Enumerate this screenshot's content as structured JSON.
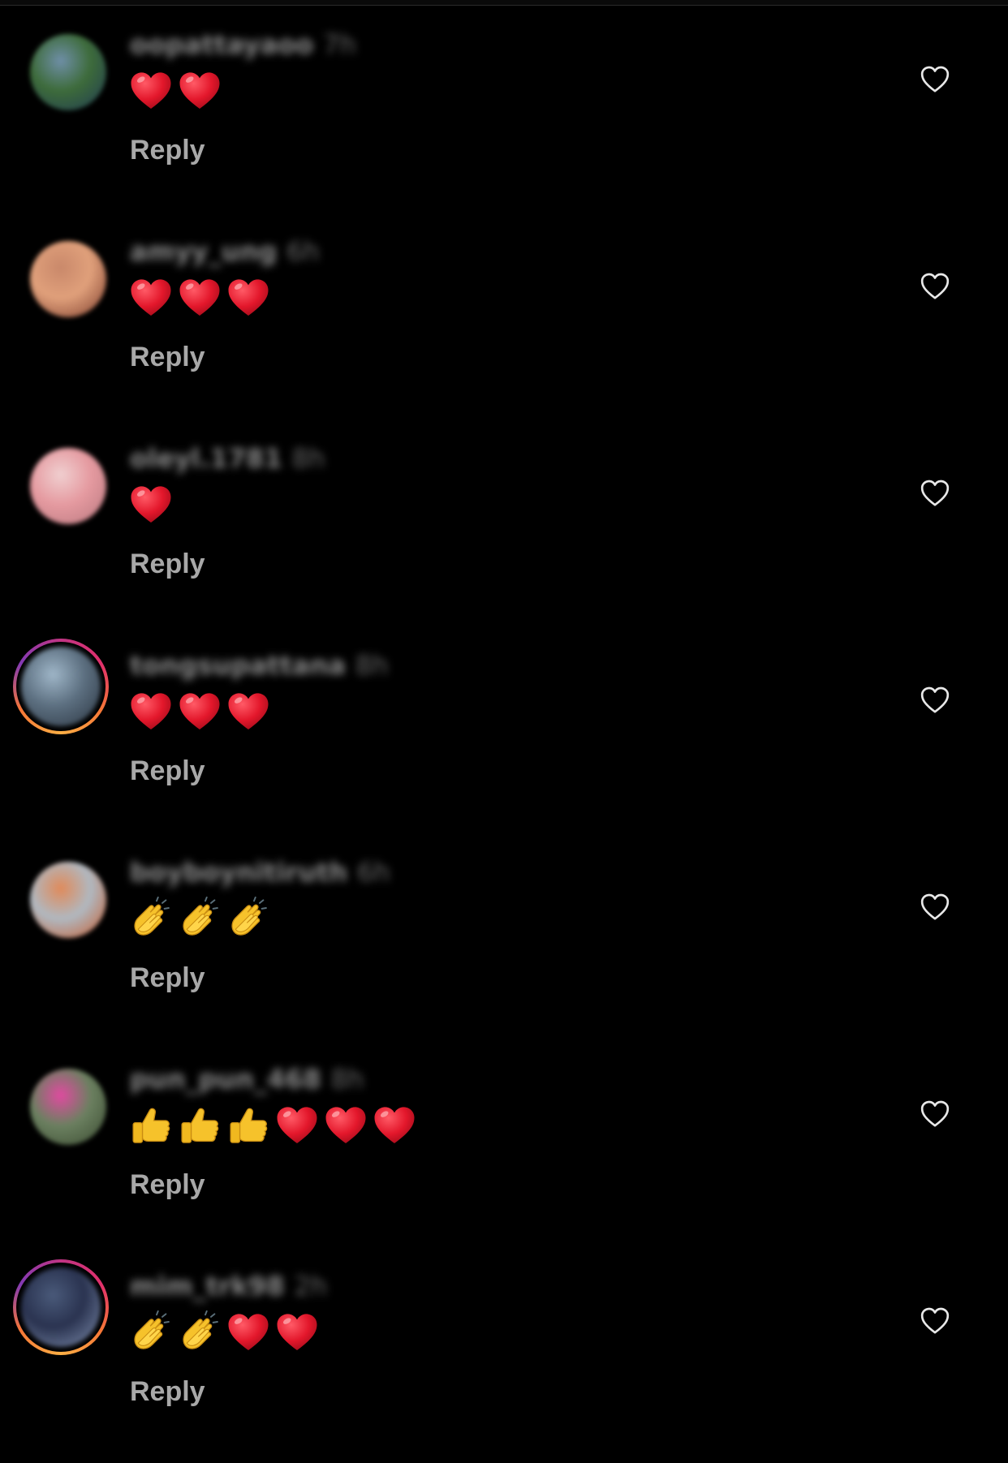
{
  "reply_label": "Reply",
  "colors": {
    "background": "#000000",
    "reply": "#a8a8a8",
    "username": "#8a8a8a",
    "heart_emoji": "#e3172b",
    "emoji_yellow": "#f6c22b",
    "like_icon": "#e8e8e8"
  },
  "comments": [
    {
      "username": "oopattayaoo",
      "time": "7h",
      "avatar_ring": false,
      "avatar_colors": [
        "#6f8fa8",
        "#3d6b3a",
        "#1f3a55"
      ],
      "emojis": [
        "heart-emoji",
        "heart-emoji"
      ]
    },
    {
      "username": "amyy_ung",
      "time": "6h",
      "avatar_ring": false,
      "avatar_colors": [
        "#c9886a",
        "#e0a07b",
        "#7a3a2a"
      ],
      "emojis": [
        "heart-emoji",
        "heart-emoji",
        "heart-emoji"
      ]
    },
    {
      "username": "oleyl.1781",
      "time": "8h",
      "avatar_ring": false,
      "avatar_colors": [
        "#f0cfd0",
        "#e59aa0",
        "#b7777e"
      ],
      "emojis": [
        "heart-emoji"
      ]
    },
    {
      "username": "tongsupattana",
      "time": "8h",
      "avatar_ring": true,
      "avatar_colors": [
        "#9fb6c8",
        "#5c6f80",
        "#2a3440"
      ],
      "emojis": [
        "heart-emoji",
        "heart-emoji",
        "heart-emoji"
      ]
    },
    {
      "username": "boyboynitiruth",
      "time": "6h",
      "avatar_ring": false,
      "avatar_colors": [
        "#e08a5a",
        "#b0b8c0",
        "#c85a2a"
      ],
      "emojis": [
        "clap-emoji",
        "clap-emoji",
        "clap-emoji"
      ]
    },
    {
      "username": "pun_pun_468",
      "time": "8h",
      "avatar_ring": false,
      "avatar_colors": [
        "#e04aa0",
        "#6b8060",
        "#3a4a30"
      ],
      "emojis": [
        "thumbs-up-emoji",
        "thumbs-up-emoji",
        "thumbs-up-emoji",
        "heart-emoji",
        "heart-emoji",
        "heart-emoji"
      ]
    },
    {
      "username": "mim_trk98",
      "time": "2h",
      "avatar_ring": true,
      "avatar_colors": [
        "#4a5a7a",
        "#2a3350",
        "#8090b0"
      ],
      "emojis": [
        "clap-emoji",
        "clap-emoji",
        "heart-emoji",
        "heart-emoji"
      ]
    }
  ]
}
